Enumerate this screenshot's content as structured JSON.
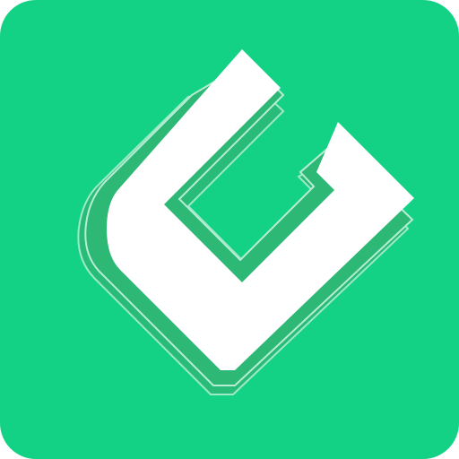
{
  "icon": {
    "name": "g-logo-app-icon",
    "background_color": "#14D285",
    "glyph_color": "#FFFFFF",
    "shadow_color": "#2DB876",
    "shadow_stroke_color": "#B7EED3"
  }
}
